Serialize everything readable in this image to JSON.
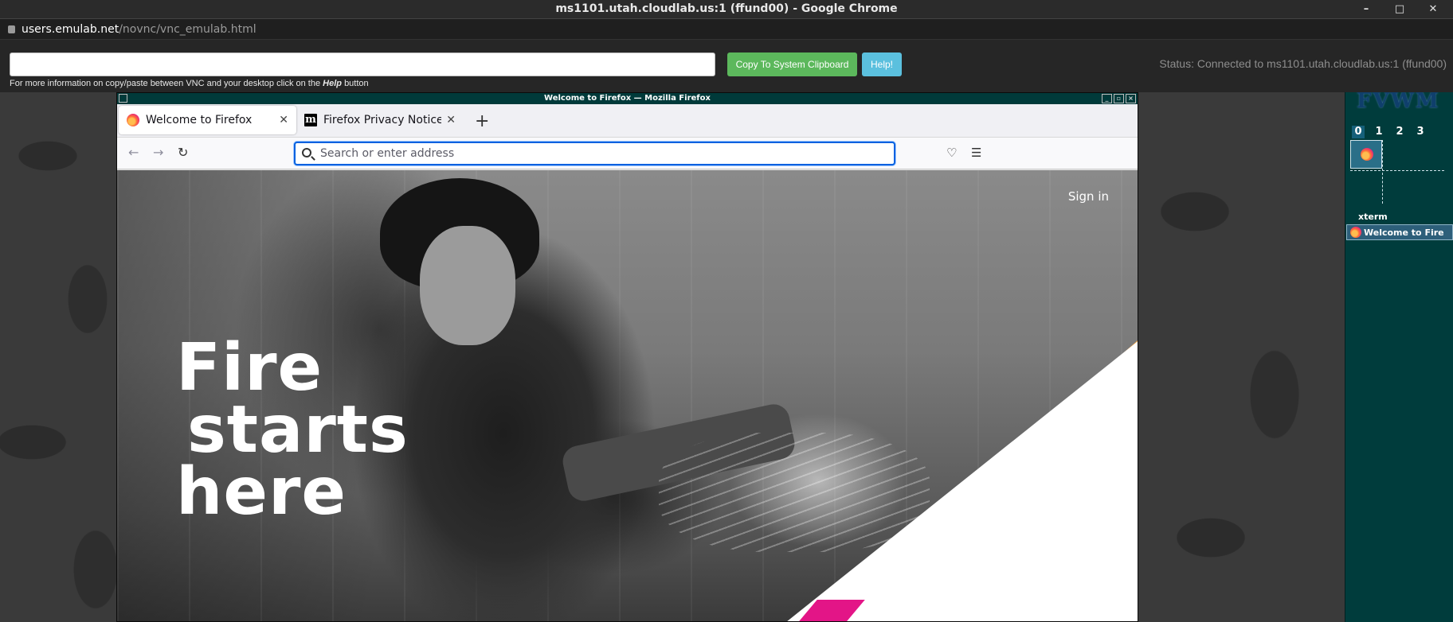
{
  "chrome": {
    "title": "ms1101.utah.cloudlab.us:1 (ffund00) - Google Chrome",
    "controls": {
      "minimize": "–",
      "maximize": "□",
      "close": "✕"
    },
    "url_host": "users.emulab.net",
    "url_path": "/novnc/vnc_emulab.html"
  },
  "vnc": {
    "clipboard_value": "",
    "copy_button": "Copy To System Clipboard",
    "help_button": "Help!",
    "status": "Status: Connected to ms1101.utah.cloudlab.us:1 (ffund00)",
    "info_prefix": "For more information on copy/paste between VNC and your desktop click on the",
    "info_help": "Help",
    "info_suffix": "button",
    "accent_green": "#5cb85c",
    "accent_blue": "#5bc0de"
  },
  "firefox": {
    "window_title": "Welcome to Firefox — Mozilla Firefox",
    "tabs": [
      {
        "label": "Welcome to Firefox",
        "icon": "firefox-icon",
        "active": true,
        "close": "✕"
      },
      {
        "label": "Firefox Privacy Notice —",
        "icon": "mozilla-m-icon",
        "active": false,
        "close": "✕"
      }
    ],
    "new_tab": "+",
    "mozilla_favicon_letter": "m",
    "nav": {
      "back": "←",
      "forward": "→",
      "reload": "↻",
      "pocket": "♡",
      "menu": "☰"
    },
    "address_placeholder": "Search or enter address",
    "page": {
      "sign_in": "Sign in",
      "headline_line1": "Fire",
      "headline_line2": "starts",
      "headline_line3": "here",
      "accent_orange": "#ffa436",
      "accent_pink": "#e31587"
    }
  },
  "fvwm": {
    "logo": "FVWM",
    "desks": [
      "0",
      "1",
      "2",
      "3"
    ],
    "current_desk": "0",
    "window_list": [
      {
        "label": "xterm"
      },
      {
        "label": "Welcome to Fire",
        "icon": "firefox-icon"
      }
    ]
  }
}
